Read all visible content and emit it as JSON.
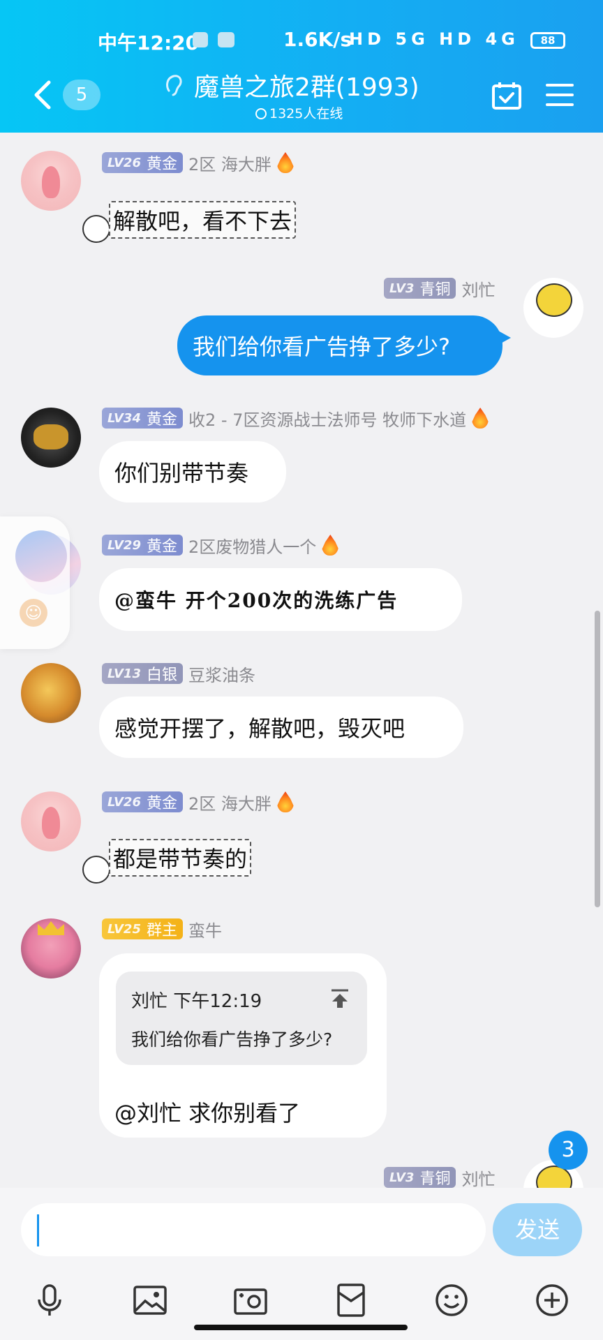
{
  "status_bar": {
    "time": "中午12:20",
    "net_speed": "1.6K/s",
    "signal": "HD 5G HD 4G",
    "battery": "88"
  },
  "header": {
    "unread": "5",
    "title": "魔兽之旅2群(1993)",
    "online": "1325人在线"
  },
  "messages": [
    {
      "id": "m1",
      "level": "LV26",
      "tier": "黄金",
      "nick": "2区 海大胖",
      "text": "解散吧，看不下去",
      "fire": true
    },
    {
      "id": "m2",
      "level": "LV3",
      "tier": "青铜",
      "nick": "刘忙",
      "text": "我们给你看广告挣了多少?",
      "self": true
    },
    {
      "id": "m3",
      "level": "LV34",
      "tier": "黄金",
      "nick": "收2 - 7区资源战士法师号 牧师下水道",
      "text": "你们别带节奏",
      "fire": true
    },
    {
      "id": "m4",
      "level": "LV29",
      "tier": "黄金",
      "nick": "2区废物猎人一个",
      "text": "@蛮牛 开个200次的洗练广告",
      "fire": true
    },
    {
      "id": "m5",
      "level": "LV13",
      "tier": "白银",
      "nick": "豆浆油条",
      "text": "感觉开摆了，解散吧，毁灭吧"
    },
    {
      "id": "m6",
      "level": "LV26",
      "tier": "黄金",
      "nick": "2区 海大胖",
      "text": "都是带节奏的",
      "fire": true
    },
    {
      "id": "m7",
      "level": "LV25",
      "tier": "群主",
      "nick": "蛮牛",
      "quote": {
        "author_time": "刘忙 下午12:19",
        "text": "我们给你看广告挣了多少?"
      },
      "text": "@刘忙 求你别看了"
    },
    {
      "id": "m8",
      "level": "LV3",
      "tier": "青铜",
      "nick": "刘忙",
      "self": true
    }
  ],
  "new_message_count": "3",
  "input": {
    "placeholder": "",
    "send_label": "发送"
  },
  "toolbar": [
    "microphone-icon",
    "image-icon",
    "camera-icon",
    "red-packet-icon",
    "emoji-icon",
    "plus-icon"
  ],
  "colors": {
    "header": "#14adf3",
    "self_bubble": "#1593ee",
    "send_button": "#9cd4f8",
    "owner_badge": "#f4b218"
  }
}
